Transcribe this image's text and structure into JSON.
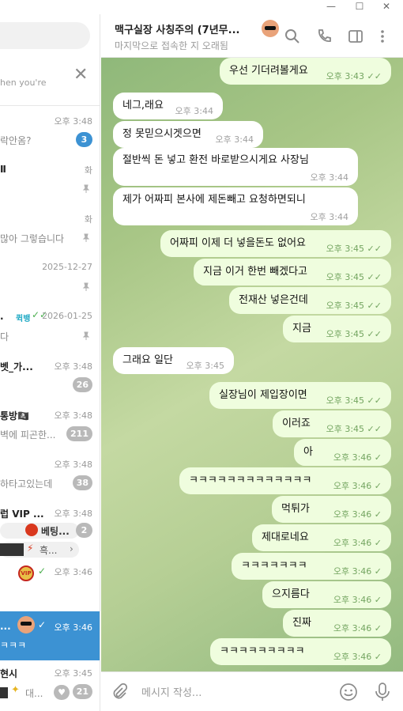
{
  "sidebar": {
    "notice_text": "hen you're",
    "chats": [
      {
        "name": "",
        "time": "오후 3:48",
        "preview": "락안옴?",
        "badge": "3"
      },
      {
        "name": "Ⅱ",
        "time": "화",
        "preview": ""
      },
      {
        "name": "",
        "time": "화",
        "preview": "많아 그렇습니다"
      },
      {
        "name": "",
        "time": "2025-12-27",
        "preview": ""
      },
      {
        "name": ".",
        "time": "2026-01-25",
        "preview": "다",
        "tag": "퀵뱅"
      },
      {
        "name": "벳_가...",
        "time": "오후 3:48",
        "preview": "",
        "badge": "26"
      },
      {
        "name": "통방🏴‍☠️",
        "time": "오후 3:48",
        "preview": "벽에 피곤한...",
        "badge": "211"
      },
      {
        "name": "",
        "time": "오후 3:48",
        "preview": "하타고있는데",
        "badge": "38"
      },
      {
        "name": "럽 VIP ...",
        "time": "오후 3:48",
        "preview": "베팅...",
        "badge": "2",
        "preview2": "흑..."
      },
      {
        "name": "",
        "time": "오후 3:46",
        "preview": ""
      },
      {
        "name": "...",
        "time": "오후 3:46",
        "preview": "ㅋㅋㅋ"
      },
      {
        "name": "현시",
        "time": "오후 3:45",
        "preview": "대...",
        "badge": "21"
      }
    ]
  },
  "header": {
    "title": "맥구실장 사칭주의 (7년무...",
    "subtitle": "마지막으로 접속한 지 오래됨"
  },
  "messages": [
    {
      "dir": "out",
      "text": "우선 기더려볼게요",
      "time": "오후 3:43"
    },
    {
      "dir": "in",
      "text": "네그,래요",
      "time": "오후 3:44"
    },
    {
      "dir": "in",
      "text": "정 못믿으시겟으면",
      "time": "오후 3:44"
    },
    {
      "dir": "in",
      "text": "절반씩 돈 넣고 환전 바로받으시게요 사장님",
      "time": "오후 3:44"
    },
    {
      "dir": "in",
      "text": "제가 어짜피 본사에 제돈빼고 요청하면되니",
      "time": "오후 3:44"
    },
    {
      "dir": "out",
      "text": "어짜피 이제 더 넣을돈도 없어요",
      "time": "오후 3:45"
    },
    {
      "dir": "out",
      "text": "지금 이거 한번 빼겠다고",
      "time": "오후 3:45"
    },
    {
      "dir": "out",
      "text": "전재산 넣은건데",
      "time": "오후 3:45"
    },
    {
      "dir": "out",
      "text": "지금",
      "time": "오후 3:45"
    },
    {
      "dir": "in",
      "text": "그래요 일단",
      "time": "오후 3:45"
    },
    {
      "dir": "out",
      "text": "실장님이 제입장이면",
      "time": "오후 3:45"
    },
    {
      "dir": "out",
      "text": "이러죠",
      "time": "오후 3:45"
    },
    {
      "dir": "out",
      "text": "아",
      "time": "오후 3:46"
    },
    {
      "dir": "out",
      "text": "ㅋㅋㅋㅋㅋㅋㅋㅋㅋㅋㅋㅋㅋ",
      "time": "오후 3:46"
    },
    {
      "dir": "out",
      "text": "먹튀가",
      "time": "오후 3:46"
    },
    {
      "dir": "out",
      "text": "제대로네요",
      "time": "오후 3:46"
    },
    {
      "dir": "out",
      "text": "ㅋㅋㅋㅋㅋㅋㅋ",
      "time": "오후 3:46"
    },
    {
      "dir": "out",
      "text": "으지름다",
      "time": "오후 3:46"
    },
    {
      "dir": "out",
      "text": "진짜",
      "time": "오후 3:46"
    },
    {
      "dir": "out",
      "text": "ㅋㅋㅋㅋㅋㅋㅋㅋㅋ",
      "time": "오후 3:46"
    }
  ],
  "composer": {
    "placeholder": "메시지 작성..."
  },
  "icons": [
    "minimize-icon",
    "maximize-icon",
    "close-icon",
    "search-icon",
    "phone-icon",
    "sidebar-toggle-icon",
    "more-icon",
    "attach-icon",
    "emoji-icon",
    "mic-icon",
    "pin-icon",
    "double-check-icon"
  ],
  "colors": {
    "accent": "#3c92d3",
    "outgoing_bubble": "#effdde",
    "incoming_bubble": "#ffffff",
    "chat_bg": "#a8c686"
  }
}
